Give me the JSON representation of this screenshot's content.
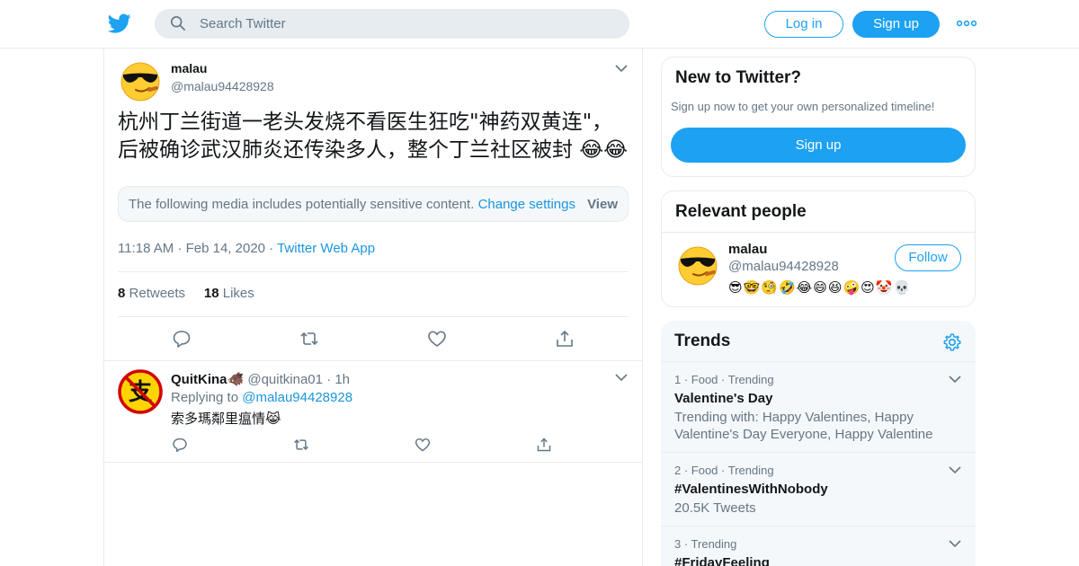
{
  "header": {
    "search_placeholder": "Search Twitter",
    "login_label": "Log in",
    "signup_label": "Sign up"
  },
  "tweet": {
    "author_name": "malau",
    "author_handle": "@malau94428928",
    "text": "杭州丁兰街道一老头发烧不看医生狂吃\"神药双黄连\"，后被确诊武汉肺炎还传染多人，整个丁兰社区被封 😂😂",
    "sensitive_notice": "The following media includes potentially sensitive content.",
    "change_settings": "Change settings",
    "view_label": "View",
    "time": "11:18 AM",
    "date": "Feb 14, 2020",
    "source": "Twitter Web App",
    "retweets_count": "8",
    "retweets_label": "Retweets",
    "likes_count": "18",
    "likes_label": "Likes"
  },
  "reply": {
    "author_name": "QuitKina🐗",
    "author_handle": "@quitkina01",
    "time": "1h",
    "replying_to_label": "Replying to",
    "replying_to_handle": "@malau94428928",
    "text": "索多瑪鄰里瘟情😹"
  },
  "sidebar": {
    "new_title": "New to Twitter?",
    "new_subtitle": "Sign up now to get your own personalized timeline!",
    "new_signup": "Sign up",
    "relevant_title": "Relevant people",
    "person_name": "malau",
    "person_handle": "@malau94428928",
    "follow_label": "Follow",
    "person_bio": "😎🤓🧐🤣😂😄😆🤪😍🤡💀",
    "trends_title": "Trends",
    "trends": [
      {
        "meta": "1 · Food · Trending",
        "name": "Valentine's Day",
        "desc": "Trending with: Happy Valentines, Happy Valentine's Day Everyone, Happy Valentine"
      },
      {
        "meta": "2 · Food · Trending",
        "name": "#ValentinesWithNobody",
        "desc": "20.5K Tweets"
      },
      {
        "meta": "3 · Trending",
        "name": "#FridayFeeling",
        "desc": ""
      }
    ]
  },
  "colors": {
    "brand": "#1da1f2",
    "link": "#1b95e0",
    "muted": "#657786",
    "border": "#e6ecf0"
  }
}
